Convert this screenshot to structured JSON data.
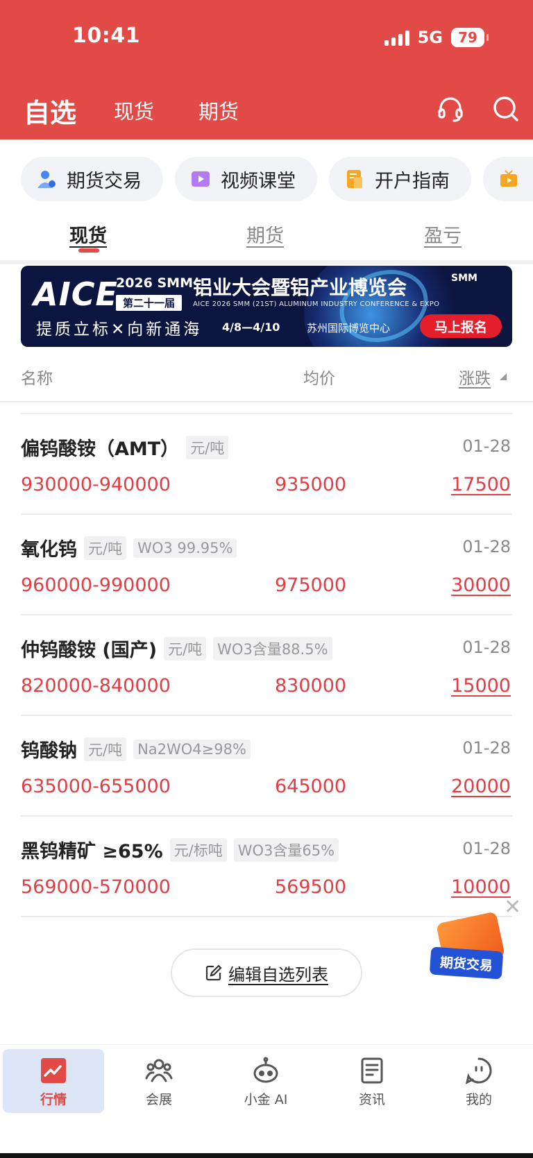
{
  "status_bar": {
    "time": "10:41",
    "network": "5G",
    "battery": "79"
  },
  "nav": {
    "title": "自选",
    "tabs": [
      "现货",
      "期货"
    ]
  },
  "shortcuts": [
    {
      "label": "期货交易",
      "icon": "user-trade-icon",
      "color": "#4a86f0"
    },
    {
      "label": "视频课堂",
      "icon": "video-icon",
      "color": "#a35cf0"
    },
    {
      "label": "开户指南",
      "icon": "document-icon",
      "color": "#f5a623"
    },
    {
      "label": "",
      "icon": "tv-icon",
      "color": "#f5a623"
    }
  ],
  "sub_tabs": [
    {
      "label": "现货",
      "active": true
    },
    {
      "label": "期货",
      "active": false
    },
    {
      "label": "盈亏",
      "active": false
    }
  ],
  "banner": {
    "logo": "AICE",
    "year": "2026 SMM",
    "session": "第二十一届",
    "title": "铝业大会暨铝产业博览会",
    "subtitle": "AICE 2026 SMM (21ST) ALUMINUM INDUSTRY CONFERENCE & EXPO",
    "slogan": "提质立标✕向新通海",
    "date": "4/8—4/10",
    "venue": "苏州国际博览中心",
    "cta": "马上报名",
    "brand": "SMM"
  },
  "table": {
    "headers": {
      "name": "名称",
      "avg": "均价",
      "change": "涨跌"
    },
    "rows": [
      {
        "name": "偏钨酸铵（AMT）",
        "tags": [
          "元/吨"
        ],
        "date": "01-28",
        "range": "930000-940000",
        "avg": "935000",
        "change": "17500"
      },
      {
        "name": "氧化钨",
        "tags": [
          "元/吨",
          "WO3 99.95%"
        ],
        "date": "01-28",
        "range": "960000-990000",
        "avg": "975000",
        "change": "30000"
      },
      {
        "name": "仲钨酸铵 (国产)",
        "tags": [
          "元/吨",
          "WO3含量88.5%"
        ],
        "date": "01-28",
        "range": "820000-840000",
        "avg": "830000",
        "change": "15000"
      },
      {
        "name": "钨酸钠",
        "tags": [
          "元/吨",
          "Na2WO4≥98%"
        ],
        "date": "01-28",
        "range": "635000-655000",
        "avg": "645000",
        "change": "20000"
      },
      {
        "name": "黑钨精矿 ≥65%",
        "tags": [
          "元/标吨",
          "WO3含量65%"
        ],
        "date": "01-28",
        "range": "569000-570000",
        "avg": "569500",
        "change": "10000"
      }
    ]
  },
  "edit_list_label": "编辑自选列表",
  "float_promo": {
    "label": "期货交易"
  },
  "tabbar": [
    {
      "label": "行情",
      "icon": "market-chart-icon",
      "active": true
    },
    {
      "label": "会展",
      "icon": "people-icon",
      "active": false
    },
    {
      "label": "小金 AI",
      "icon": "robot-icon",
      "active": false
    },
    {
      "label": "资讯",
      "icon": "news-icon",
      "active": false
    },
    {
      "label": "我的",
      "icon": "profile-face-icon",
      "active": false
    }
  ],
  "colors": {
    "header": "#e14a46",
    "price": "#e23c44",
    "active_tab_bg": "#dde6f6"
  }
}
